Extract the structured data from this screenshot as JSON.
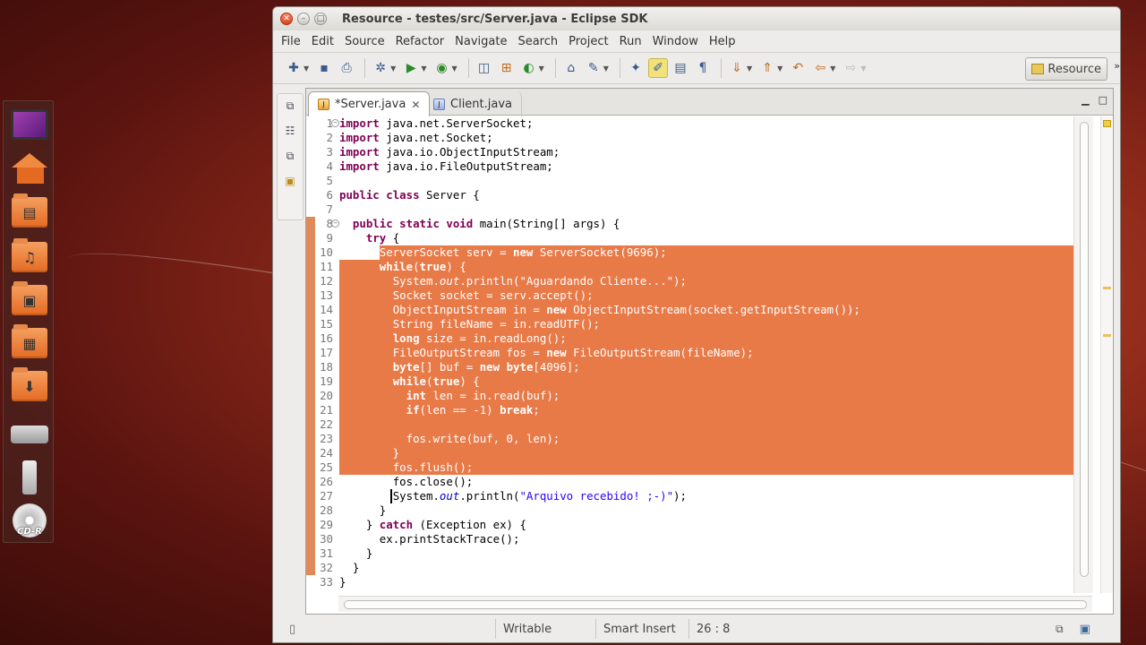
{
  "window": {
    "title": "Resource - testes/src/Server.java - Eclipse SDK"
  },
  "menu": [
    "File",
    "Edit",
    "Source",
    "Refactor",
    "Navigate",
    "Search",
    "Project",
    "Run",
    "Window",
    "Help"
  ],
  "toolbar": {
    "perspective_label": "Resource"
  },
  "launcher": {
    "cd_label": "CD-R"
  },
  "editor": {
    "tabs": [
      {
        "label": "*Server.java",
        "active": true
      },
      {
        "label": "Client.java",
        "active": false
      }
    ],
    "lines": [
      {
        "n": "1",
        "text": "import java.net.ServerSocket;"
      },
      {
        "n": "2",
        "text": "import java.net.Socket;"
      },
      {
        "n": "3",
        "text": "import java.io.ObjectInputStream;"
      },
      {
        "n": "4",
        "text": "import java.io.FileOutputStream;"
      },
      {
        "n": "5",
        "text": ""
      },
      {
        "n": "6",
        "text": "public class Server {"
      },
      {
        "n": "7",
        "text": ""
      },
      {
        "n": "8",
        "text": "  public static void main(String[] args) {"
      },
      {
        "n": "9",
        "text": "    try {"
      },
      {
        "n": "10",
        "text": "      ServerSocket serv = new ServerSocket(9696);"
      },
      {
        "n": "11",
        "text": "      while(true) {"
      },
      {
        "n": "12",
        "text": "        System.out.println(\"Aguardando Cliente...\");"
      },
      {
        "n": "13",
        "text": "        Socket socket = serv.accept();"
      },
      {
        "n": "14",
        "text": "        ObjectInputStream in = new ObjectInputStream(socket.getInputStream());"
      },
      {
        "n": "15",
        "text": "        String fileName = in.readUTF();"
      },
      {
        "n": "16",
        "text": "        long size = in.readLong();"
      },
      {
        "n": "17",
        "text": "        FileOutputStream fos = new FileOutputStream(fileName);"
      },
      {
        "n": "18",
        "text": "        byte[] buf = new byte[4096];"
      },
      {
        "n": "19",
        "text": "        while(true) {"
      },
      {
        "n": "20",
        "text": "          int len = in.read(buf);"
      },
      {
        "n": "21",
        "text": "          if(len == -1) break;"
      },
      {
        "n": "22",
        "text": ""
      },
      {
        "n": "23",
        "text": "          fos.write(buf, 0, len);"
      },
      {
        "n": "24",
        "text": "        }"
      },
      {
        "n": "25",
        "text": "        fos.flush();"
      },
      {
        "n": "26",
        "text": "        fos.close();"
      },
      {
        "n": "27",
        "text": "        System.out.println(\"Arquivo recebido! ;-)\");"
      },
      {
        "n": "28",
        "text": "      }"
      },
      {
        "n": "29",
        "text": "    } catch (Exception ex) {"
      },
      {
        "n": "30",
        "text": "      ex.printStackTrace();"
      },
      {
        "n": "31",
        "text": "    }"
      },
      {
        "n": "32",
        "text": "  }"
      },
      {
        "n": "33",
        "text": "}"
      }
    ],
    "selected_lines": [
      "10",
      "25"
    ]
  },
  "status": {
    "writable": "Writable",
    "insert_mode": "Smart Insert",
    "position": "26 : 8"
  },
  "colors": {
    "selection": "#e87a48",
    "keyword": "#7f0055",
    "string": "#2a00ff"
  }
}
